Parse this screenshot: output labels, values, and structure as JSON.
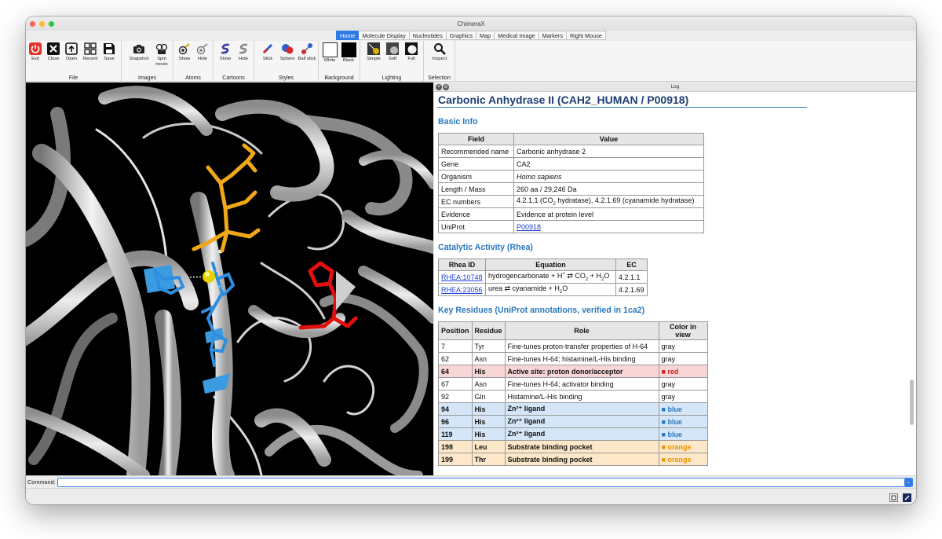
{
  "window": {
    "title": "ChimeraX"
  },
  "tabs": [
    "Home",
    "Molecule Display",
    "Nucleotides",
    "Graphics",
    "Map",
    "Medical Image",
    "Markers",
    "Right Mouse"
  ],
  "ribbon": {
    "groups": [
      {
        "name": "File",
        "buttons": [
          {
            "label": "Exit",
            "icon": "power-icon"
          },
          {
            "label": "Close",
            "icon": "close-icon"
          },
          {
            "label": "Open",
            "icon": "open-icon"
          },
          {
            "label": "Recent",
            "icon": "recent-icon"
          },
          {
            "label": "Save",
            "icon": "save-icon"
          }
        ]
      },
      {
        "name": "Images",
        "buttons": [
          {
            "label": "Snapshot",
            "icon": "camera-icon"
          },
          {
            "label": "Spin movie",
            "icon": "spin-movie-icon"
          }
        ]
      },
      {
        "name": "Atoms",
        "buttons": [
          {
            "label": "Show",
            "icon": "atoms-show-icon"
          },
          {
            "label": "Hide",
            "icon": "atoms-hide-icon"
          }
        ]
      },
      {
        "name": "Cartoons",
        "buttons": [
          {
            "label": "Show",
            "icon": "cartoon-show-icon"
          },
          {
            "label": "Hide",
            "icon": "cartoon-hide-icon"
          }
        ]
      },
      {
        "name": "Styles",
        "buttons": [
          {
            "label": "Stick",
            "icon": "stick-icon"
          },
          {
            "label": "Sphere",
            "icon": "sphere-icon"
          },
          {
            "label": "Ball stick",
            "icon": "ball-stick-icon"
          }
        ]
      },
      {
        "name": "Background",
        "buttons": [
          {
            "label": "White",
            "icon": "white-background-icon"
          },
          {
            "label": "Black",
            "icon": "black-background-icon"
          }
        ]
      },
      {
        "name": "Lighting",
        "buttons": [
          {
            "label": "Simple",
            "icon": "simple-lighting-icon"
          },
          {
            "label": "Soft",
            "icon": "soft-lighting-icon"
          },
          {
            "label": "Full",
            "icon": "full-lighting-icon"
          }
        ]
      },
      {
        "name": "Selection",
        "buttons": [
          {
            "label": "Inspect",
            "icon": "inspect-icon"
          }
        ]
      }
    ]
  },
  "log": {
    "panel_title": "Log",
    "title": "Carbonic Anhydrase II (CAH2_HUMAN / P00918)",
    "basic_info_heading": "Basic Info",
    "basic_info_headers": [
      "Field",
      "Value"
    ],
    "basic_info": [
      {
        "field": "Recommended name",
        "value": "Carbonic anhydrase 2"
      },
      {
        "field": "Gene",
        "value": "CA2"
      },
      {
        "field": "Organism",
        "value": "Homo sapiens"
      },
      {
        "field": "Length / Mass",
        "value": "260 aa / 29,246 Da"
      },
      {
        "field": "EC numbers",
        "pre": "4.2.1.1 (CO",
        "sub": "2",
        "post": " hydratase), 4.2.1.69 (cyanamide hydratase)"
      },
      {
        "field": "Evidence",
        "value": "Evidence at protein level"
      },
      {
        "field": "UniProt",
        "value": "P00918"
      }
    ],
    "catalytic_heading": "Catalytic Activity (Rhea)",
    "catalytic_headers": [
      "Rhea ID",
      "Equation",
      "EC"
    ],
    "catalytic": [
      {
        "id": "RHEA:10748",
        "eq_a": "hydrogencarbonate + H",
        "eq_sup": "+",
        "eq_b": " ⇄ CO",
        "eq_sub1": "2",
        "eq_c": " + H",
        "eq_sub2": "2",
        "eq_d": "O",
        "ec": "4.2.1.1"
      },
      {
        "id": "RHEA:23056",
        "eq_a": "urea ⇄ cyanamide + H",
        "eq_sub": "2",
        "eq_b": "O",
        "ec": "4.2.1.69"
      }
    ],
    "residues_heading": "Key Residues (UniProt annotations, verified in 1ca2)",
    "residues_headers": [
      "Position",
      "Residue",
      "Role",
      "Color in view"
    ],
    "residues": [
      {
        "position": "7",
        "residue": "Tyr",
        "role": "Fine-tunes proton-transfer properties of H-64",
        "color": "gray"
      },
      {
        "position": "62",
        "residue": "Asn",
        "role": "Fine-tunes H-64; histamine/L-His binding",
        "color": "gray"
      },
      {
        "position": "64",
        "residue": "His",
        "role": "Active site: proton donor/acceptor",
        "color": "■ red"
      },
      {
        "position": "67",
        "residue": "Asn",
        "role": "Fine-tunes H-64; activator binding",
        "color": "gray"
      },
      {
        "position": "92",
        "residue": "Gln",
        "role": "Histamine/L-His binding",
        "color": "gray"
      },
      {
        "position": "94",
        "residue": "His",
        "role": "Zn²⁺ ligand",
        "color": "■ blue"
      },
      {
        "position": "96",
        "residue": "His",
        "role": "Zn²⁺ ligand",
        "color": "■ blue"
      },
      {
        "position": "119",
        "residue": "His",
        "role": "Zn²⁺ ligand",
        "color": "■ blue"
      },
      {
        "position": "198",
        "residue": "Leu",
        "role": "Substrate binding pocket",
        "color": "■ orange"
      },
      {
        "position": "199",
        "residue": "Thr",
        "role": "Substrate binding pocket",
        "color": "■ orange"
      }
    ]
  },
  "command": {
    "label": "Command:",
    "value": ""
  },
  "colors": {
    "accent": "#2f7ae5",
    "heading": "#2a78c0",
    "red": "#d41d1d",
    "blue": "#2a78c0",
    "orange": "#e69500",
    "zinc": "#e8d200"
  }
}
